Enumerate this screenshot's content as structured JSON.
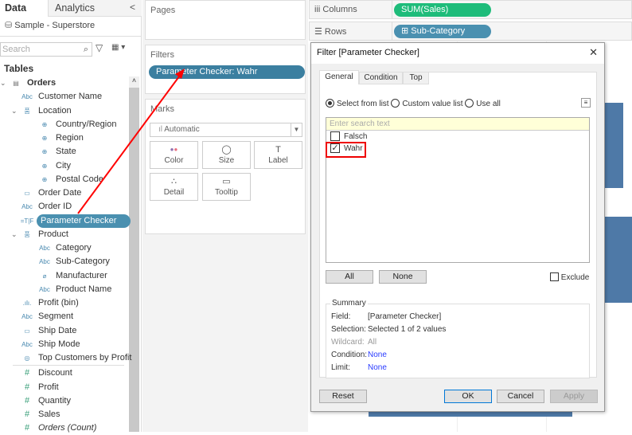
{
  "left": {
    "tabs": [
      "Data",
      "Analytics"
    ],
    "collapse": "<",
    "datasource": "Sample - Superstore",
    "search_placeholder": "Search",
    "tables_heading": "Tables",
    "fields": [
      {
        "label": "Orders",
        "icon": "table",
        "indent": 0,
        "bold": true,
        "chev": "⌄"
      },
      {
        "label": "Customer Name",
        "icon": "Abc",
        "indent": 1
      },
      {
        "label": "Location",
        "icon": "hier",
        "indent": 1,
        "chev": "⌄"
      },
      {
        "label": "Country/Region",
        "icon": "globe",
        "indent": 2
      },
      {
        "label": "Region",
        "icon": "globe",
        "indent": 2
      },
      {
        "label": "State",
        "icon": "globe",
        "indent": 2
      },
      {
        "label": "City",
        "icon": "globe",
        "indent": 2
      },
      {
        "label": "Postal Code",
        "icon": "globe",
        "indent": 2
      },
      {
        "label": "Order Date",
        "icon": "date",
        "indent": 1
      },
      {
        "label": "Order ID",
        "icon": "Abc",
        "indent": 1
      },
      {
        "label": "Parameter Checker",
        "icon": "=T|F",
        "indent": 1,
        "selected": true
      },
      {
        "label": "Product",
        "icon": "hier",
        "indent": 1,
        "chev": "⌄"
      },
      {
        "label": "Category",
        "icon": "Abc",
        "indent": 2
      },
      {
        "label": "Sub-Category",
        "icon": "Abc",
        "indent": 2
      },
      {
        "label": "Manufacturer",
        "icon": "clip",
        "indent": 2
      },
      {
        "label": "Product Name",
        "icon": "Abc",
        "indent": 2
      },
      {
        "label": "Profit (bin)",
        "icon": "bin",
        "indent": 1
      },
      {
        "label": "Segment",
        "icon": "Abc",
        "indent": 1
      },
      {
        "label": "Ship Date",
        "icon": "date",
        "indent": 1
      },
      {
        "label": "Ship Mode",
        "icon": "Abc",
        "indent": 1
      },
      {
        "label": "Top Customers by Profit",
        "icon": "set",
        "indent": 1
      },
      {
        "label": "Discount",
        "icon": "#",
        "indent": 1,
        "measure": true
      },
      {
        "label": "Profit",
        "icon": "#",
        "indent": 1,
        "measure": true
      },
      {
        "label": "Quantity",
        "icon": "#",
        "indent": 1,
        "measure": true
      },
      {
        "label": "Sales",
        "icon": "#",
        "indent": 1,
        "measure": true
      },
      {
        "label": "Orders (Count)",
        "icon": "#",
        "indent": 1,
        "measure": true,
        "italic": true
      }
    ]
  },
  "mid": {
    "pages": "Pages",
    "filters": "Filters",
    "filter_pill": "Parameter Checker: Wahr",
    "marks": "Marks",
    "mark_type": "Automatic",
    "mark_buttons": [
      {
        "label": "Color",
        "icon": "●●"
      },
      {
        "label": "Size",
        "icon": "◯"
      },
      {
        "label": "Label",
        "icon": "T"
      },
      {
        "label": "Detail",
        "icon": "∴"
      },
      {
        "label": "Tooltip",
        "icon": "▭"
      }
    ]
  },
  "shelves": {
    "columns_label": "Columns",
    "columns_pill": "SUM(Sales)",
    "rows_label": "Rows",
    "rows_pill": "⊞ Sub-Category"
  },
  "dialog": {
    "title": "Filter [Parameter Checker]",
    "close": "✕",
    "tabs": [
      "General",
      "Condition",
      "Top"
    ],
    "radios": [
      "Select from list",
      "Custom value list",
      "Use all"
    ],
    "search_placeholder": "Enter search text",
    "values": [
      {
        "label": "Falsch",
        "checked": false
      },
      {
        "label": "Wahr",
        "checked": true
      }
    ],
    "all": "All",
    "none": "None",
    "exclude": "Exclude",
    "summary": {
      "heading": "Summary",
      "rows": [
        {
          "k": "Field:",
          "v": "[Parameter Checker]"
        },
        {
          "k": "Selection:",
          "v": "Selected 1 of 2 values"
        },
        {
          "k": "Wildcard:",
          "v": "All"
        },
        {
          "k": "Condition:",
          "v": "None"
        },
        {
          "k": "Limit:",
          "v": "None"
        }
      ]
    },
    "reset": "Reset",
    "ok": "OK",
    "cancel": "Cancel",
    "apply": "Apply"
  },
  "colors": {
    "accent": "#3b7fa0",
    "green": "#1ebc7a",
    "bar": "#4e79a7",
    "annotation": "#ff0000"
  }
}
